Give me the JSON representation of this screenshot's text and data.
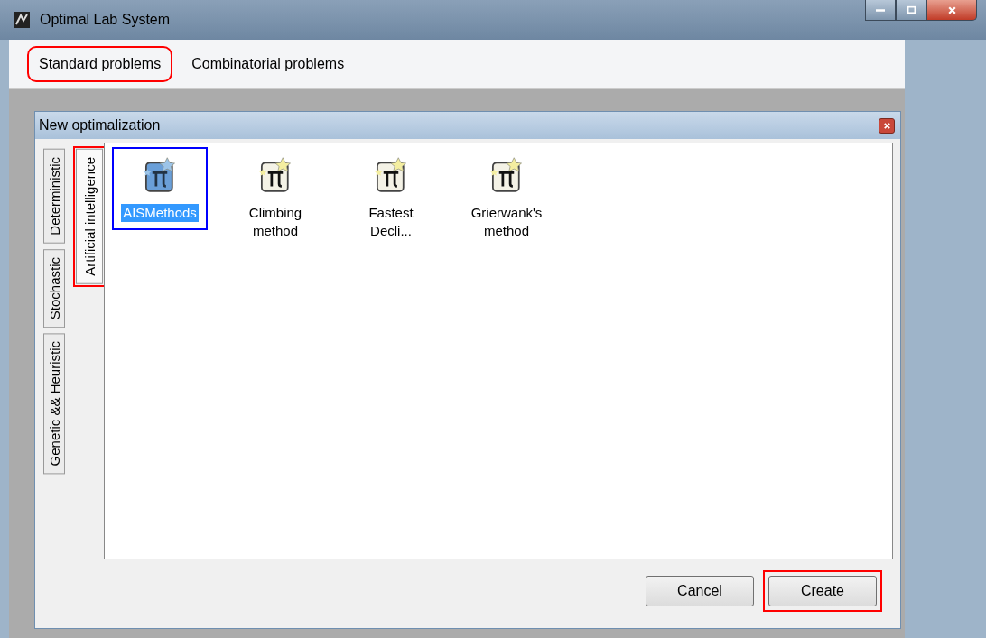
{
  "window": {
    "title": "Optimal Lab System"
  },
  "menu": [
    {
      "label": "Standard problems",
      "color": "#ff0000"
    },
    {
      "label": "Combinatorial problems"
    }
  ],
  "dialog": {
    "title": "New optimalization",
    "tab_columns": [
      [
        {
          "label": "Deterministic",
          "selected": false
        },
        {
          "label": "Stochastic",
          "selected": false
        },
        {
          "label": "Genetic && Heuristic",
          "selected": false
        }
      ],
      [
        {
          "label": "Artificial intelligence",
          "selected": true,
          "color": "#ff0000"
        }
      ]
    ],
    "items": [
      {
        "label": "AISMethods",
        "selected": true,
        "color": "#0000ff"
      },
      {
        "label": "Climbing method",
        "selected": false
      },
      {
        "label": "Fastest Decli...",
        "selected": false
      },
      {
        "label": "Grierwank's method",
        "selected": false
      }
    ],
    "buttons": [
      {
        "label": "Cancel"
      },
      {
        "label": "Create",
        "color": "#ff0000"
      }
    ]
  }
}
